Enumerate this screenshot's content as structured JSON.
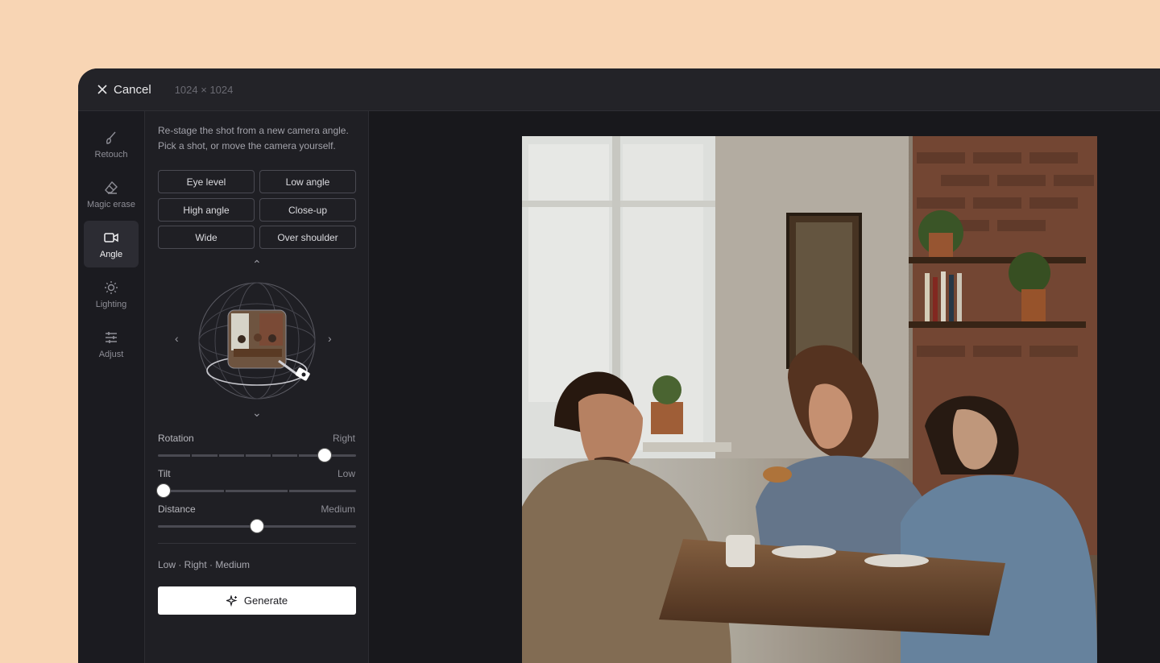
{
  "topbar": {
    "cancel_label": "Cancel",
    "dimensions": "1024 × 1024"
  },
  "tools": [
    {
      "label": "Retouch",
      "icon": "brush-icon"
    },
    {
      "label": "Magic erase",
      "icon": "eraser-icon"
    },
    {
      "label": "Angle",
      "icon": "video-camera-icon",
      "active": true
    },
    {
      "label": "Lighting",
      "icon": "sun-icon"
    },
    {
      "label": "Adjust",
      "icon": "sliders-icon"
    }
  ],
  "panel": {
    "description": "Re-stage the shot from a new camera angle. Pick a shot, or move the camera yourself.",
    "presets": [
      "Eye level",
      "Low angle",
      "High angle",
      "Close-up",
      "Wide",
      "Over shoulder"
    ],
    "sliders": {
      "rotation": {
        "label": "Rotation",
        "value": "Right",
        "position": 0.84
      },
      "tilt": {
        "label": "Tilt",
        "value": "Low",
        "position": 0.03
      },
      "distance": {
        "label": "Distance",
        "value": "Medium",
        "position": 0.5
      }
    },
    "summary": "Low · Right · Medium",
    "generate_label": "Generate"
  },
  "colors": {
    "background": "#f8d5b4",
    "window": "#1d1d22",
    "accent": "#ffffff"
  }
}
